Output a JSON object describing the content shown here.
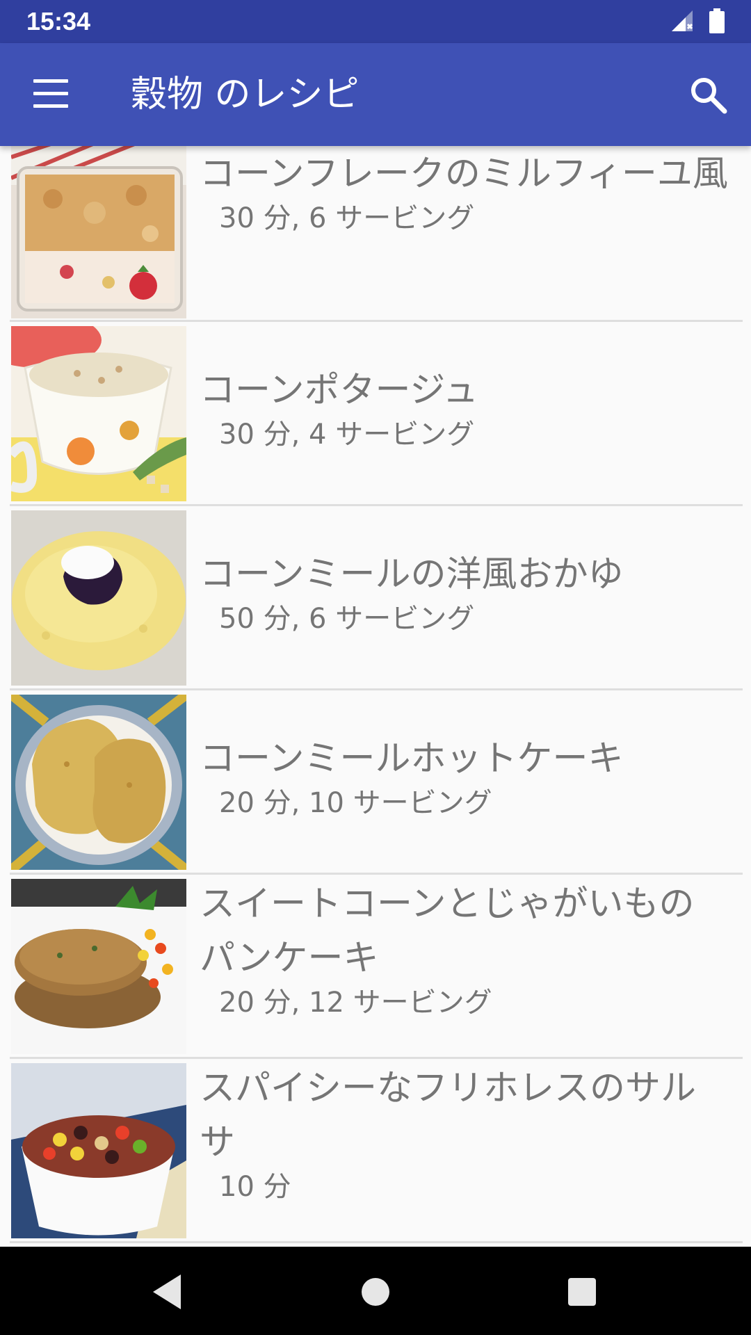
{
  "status_bar": {
    "time": "15:34",
    "icons": [
      "signal-icon",
      "battery-icon"
    ]
  },
  "app_bar": {
    "title": "穀物 のレシピ",
    "menu_icon": "menu-icon",
    "search_icon": "search-icon",
    "color": "#3f51b5",
    "status_color": "#303f9f"
  },
  "recipes": [
    {
      "title": "コーンフレークのミルフィーユ風",
      "meta": "30 分, 6 サービング"
    },
    {
      "title": "コーンポタージュ",
      "meta": "30 分, 4 サービング"
    },
    {
      "title": "コーンミールの洋風おかゆ",
      "meta": "50 分, 6 サービング"
    },
    {
      "title": "コーンミールホットケーキ",
      "meta": "20 分, 10 サービング"
    },
    {
      "title": "スイートコーンとじゃがいものパンケーキ",
      "meta": "20 分, 12 サービング"
    },
    {
      "title": "スパイシーなフリホレスのサルサ",
      "meta": "10 分"
    }
  ],
  "nav_bar": {
    "back": "back-icon",
    "home": "home-icon",
    "recents": "recents-icon"
  }
}
